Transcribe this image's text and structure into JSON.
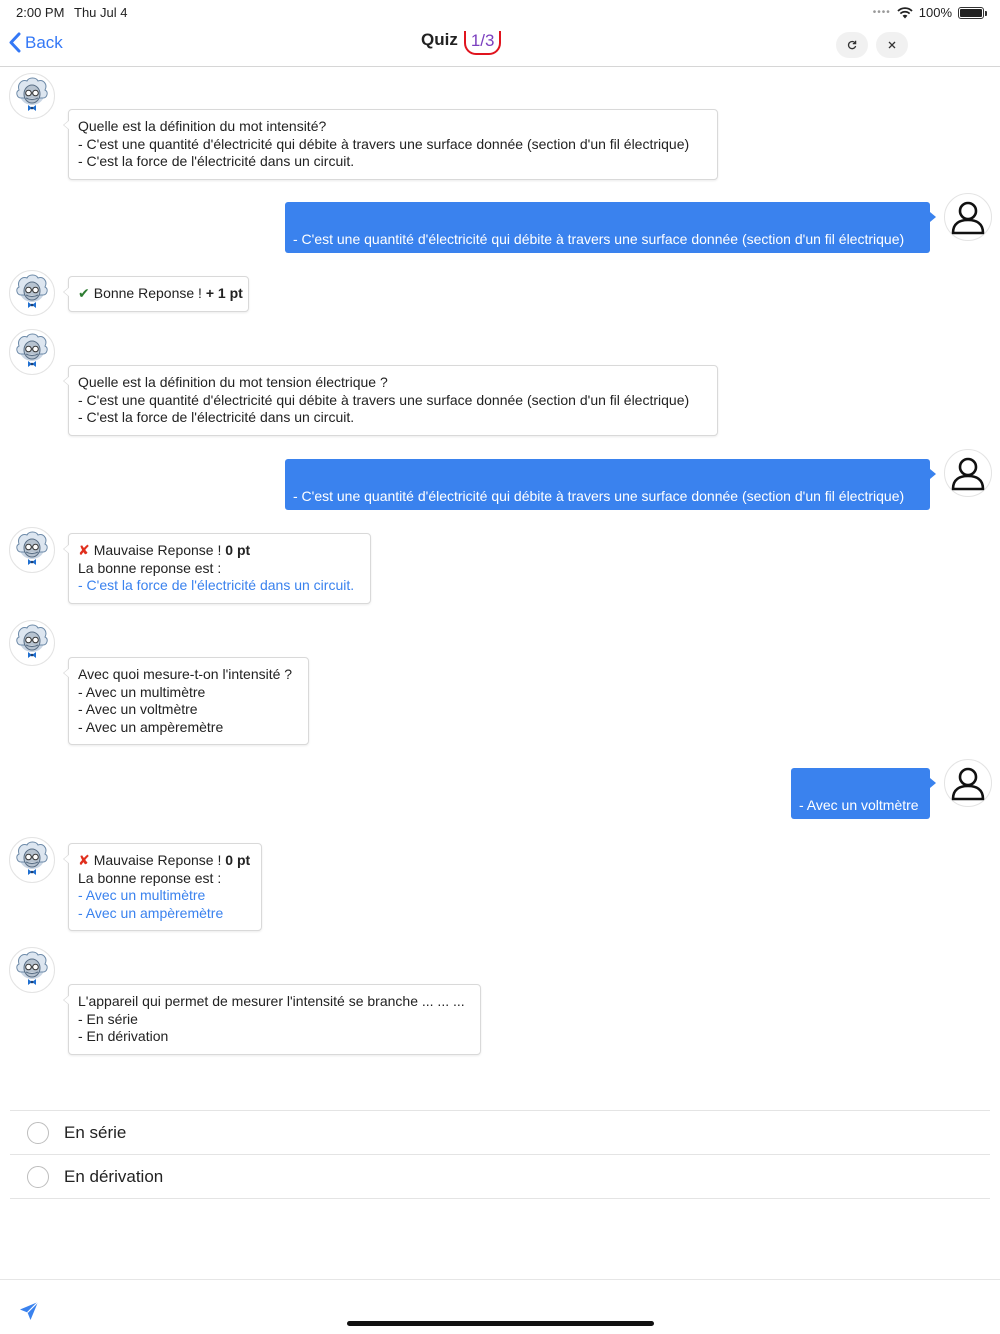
{
  "status_bar": {
    "time": "2:00 PM",
    "date": "Thu Jul 4",
    "battery": "100%"
  },
  "nav": {
    "back_label": "Back",
    "title": "Quiz",
    "counter": "1/3",
    "refresh_icon": "refresh-icon",
    "close_icon": "close-icon"
  },
  "messages": [
    {
      "from": "bot",
      "lines": [
        "Quelle est la définition du mot intensité?",
        "- C'est une quantité d'électricité qui débite à travers une surface donnée (section d'un fil électrique)",
        "- C'est la force de l'électricité dans un circuit."
      ]
    },
    {
      "from": "user",
      "text": "- C'est une quantité d'électricité qui débite à travers une surface donnée (section d'un fil électrique)"
    },
    {
      "from": "bot",
      "result_text": "Bonne Reponse ! ",
      "points": "+ 1 pt"
    },
    {
      "from": "bot",
      "lines": [
        "Quelle est la définition du mot tension électrique ?",
        "- C'est une quantité d'électricité qui débite à travers une surface donnée (section d'un fil électrique)",
        "- C'est la force de l'électricité dans un circuit."
      ]
    },
    {
      "from": "user",
      "text": "- C'est une quantité d'électricité qui débite à travers une surface donnée (section d'un fil électrique)"
    },
    {
      "from": "bot",
      "result_text": "Mauvaise Reponse ! ",
      "points": "0 pt",
      "correct_label": "La bonne reponse est :",
      "correct_lines": [
        "- C'est la force de l'électricité dans un circuit."
      ]
    },
    {
      "from": "bot",
      "lines": [
        "Avec quoi mesure-t-on l'intensité ?",
        "- Avec un multimètre",
        "- Avec un voltmètre",
        "- Avec un ampèremètre"
      ]
    },
    {
      "from": "user",
      "text": "- Avec un voltmètre"
    },
    {
      "from": "bot",
      "result_text": "Mauvaise Reponse ! ",
      "points": "0 pt",
      "correct_label": "La bonne reponse est :",
      "correct_lines": [
        "- Avec un multimètre",
        "- Avec un ampèremètre"
      ]
    },
    {
      "from": "bot",
      "lines": [
        "L'appareil qui permet de mesurer l'intensité se branche ... ... ...",
        "- En série",
        "- En dérivation"
      ]
    }
  ],
  "options": [
    "En série",
    "En dérivation"
  ],
  "icons": {
    "bot_avatar": "scientist-avatar-icon",
    "user_avatar": "user-icon",
    "check": "check-icon",
    "cross": "cross-icon",
    "send": "send-icon"
  },
  "colors": {
    "accent": "#3a82ee",
    "counter": "#7b3fbf",
    "counter_border": "#e0141e",
    "success": "#2e7d32",
    "error": "#e0301e"
  }
}
